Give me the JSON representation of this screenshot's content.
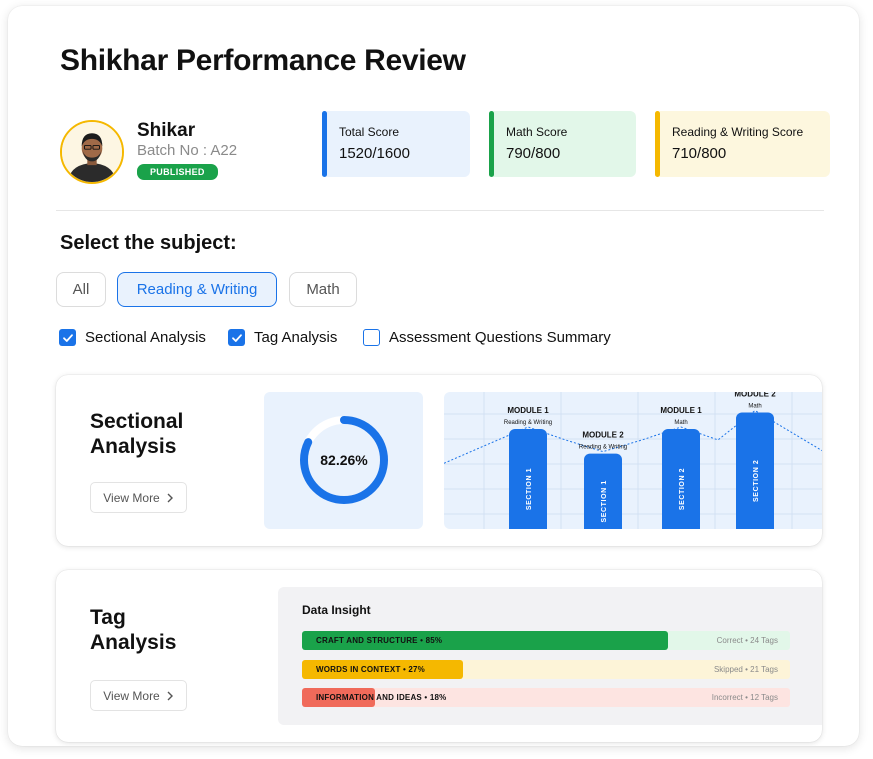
{
  "page": {
    "title": "Shikhar Performance Review"
  },
  "student": {
    "name": "Shikar",
    "batch": "Batch No : A22",
    "status": "PUBLISHED"
  },
  "scores": [
    {
      "label": "Total Score",
      "value": "1520/1600",
      "color": "#1a73e8"
    },
    {
      "label": "Math Score",
      "value": "790/800",
      "color": "#1aa24a"
    },
    {
      "label": "Reading & Writing Score",
      "value": "710/800",
      "color": "#f5b800"
    }
  ],
  "subject": {
    "title": "Select the subject:",
    "options": [
      "All",
      "Reading & Writing",
      "Math"
    ],
    "selected": "Reading & Writing"
  },
  "filters": [
    {
      "label": "Sectional Analysis",
      "checked": true
    },
    {
      "label": "Tag Analysis",
      "checked": true
    },
    {
      "label": "Assessment Questions Summary",
      "checked": false
    }
  ],
  "sectional": {
    "heading_line1": "Sectional",
    "heading_line2": "Analysis",
    "view_more": "View More",
    "percent_value": 82.26,
    "percent_label": "82.26%",
    "modules": [
      {
        "title": "MODULE 1",
        "subject": "Reading & Writing",
        "section": "SECTION 1",
        "level": 0.73
      },
      {
        "title": "MODULE 2",
        "subject": "Reading & Writing",
        "section": "SECTION 1",
        "level": 0.55
      },
      {
        "title": "MODULE 1",
        "subject": "Math",
        "section": "SECTION 2",
        "level": 0.73
      },
      {
        "title": "MODULE 2",
        "subject": "Math",
        "section": "SECTION 2",
        "level": 0.85
      }
    ]
  },
  "tag": {
    "heading_line1": "Tag",
    "heading_line2": "Analysis",
    "view_more": "View More",
    "insight_title": "Data Insight",
    "rows": [
      {
        "label": "CRAFT AND STRUCTURE • 85%",
        "percent": 75,
        "meta": "Correct  •  24 Tags",
        "fill": "#1aa24a",
        "track": "#e2f7e9"
      },
      {
        "label": "WORDS IN CONTEXT • 27%",
        "percent": 33,
        "meta": "Skipped  •  21 Tags",
        "fill": "#f5b800",
        "track": "#fdf4d8"
      },
      {
        "label": "INFORMATION AND IDEAS • 18%",
        "percent": 15,
        "meta": "Incorrect  •  12 Tags",
        "fill": "#f06a5a",
        "track": "#fde4e1"
      }
    ]
  },
  "icons": {
    "chevron": "chevron-right-icon",
    "check": "check-icon"
  },
  "colors": {
    "primary": "#1a73e8",
    "success": "#1aa24a",
    "warning": "#f5b800",
    "danger": "#f06a5a"
  }
}
